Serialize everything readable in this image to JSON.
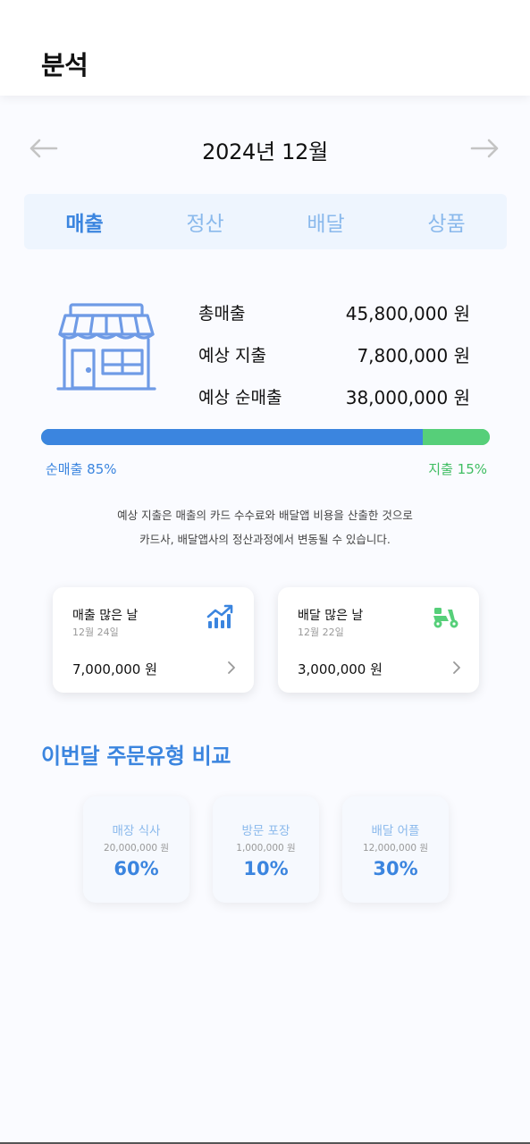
{
  "header": {
    "title": "분석"
  },
  "month_nav": {
    "label": "2024년 12월",
    "prev_icon": "arrow-left-icon",
    "next_icon": "arrow-right-icon"
  },
  "tabs": [
    {
      "label": "매출",
      "active": true
    },
    {
      "label": "정산",
      "active": false
    },
    {
      "label": "배달",
      "active": false
    },
    {
      "label": "상품",
      "active": false
    }
  ],
  "summary": {
    "icon": "store-icon",
    "rows": [
      {
        "label": "총매출",
        "value": "45,800,000 원"
      },
      {
        "label": "예상 지출",
        "value": "7,800,000 원"
      },
      {
        "label": "예상 순매출",
        "value": "38,000,000 원"
      }
    ]
  },
  "ratio_bar": {
    "net_fraction": 0.85,
    "expense_fraction": 0.15,
    "net_label": "순매출 85%",
    "expense_label": "지출 15%",
    "net_color": "#3b85df",
    "expense_color": "#56cf79"
  },
  "note": {
    "line1": "예상 지출은 매출의 카드 수수료와 배달앱 비용을 산출한 것으로",
    "line2": "카드사, 배달앱사의 정산과정에서 변동될 수 있습니다."
  },
  "highlight_cards": [
    {
      "title": "매출 많은 날",
      "date": "12월 24일",
      "value": "7,000,000 원",
      "icon": "chart-up-icon"
    },
    {
      "title": "배달 많은 날",
      "date": "12월 22일",
      "value": "3,000,000 원",
      "icon": "scooter-icon"
    }
  ],
  "order_type": {
    "title": "이번달 주문유형 비교",
    "items": [
      {
        "label": "매장 식사",
        "amount": "20,000,000 원",
        "percent": "60%"
      },
      {
        "label": "방문 포장",
        "amount": "1,000,000 원",
        "percent": "10%"
      },
      {
        "label": "배달 어플",
        "amount": "12,000,000 원",
        "percent": "30%"
      }
    ]
  },
  "colors": {
    "accent": "#3b85df",
    "green": "#56cf79",
    "tab_bg": "#eef5fe"
  }
}
